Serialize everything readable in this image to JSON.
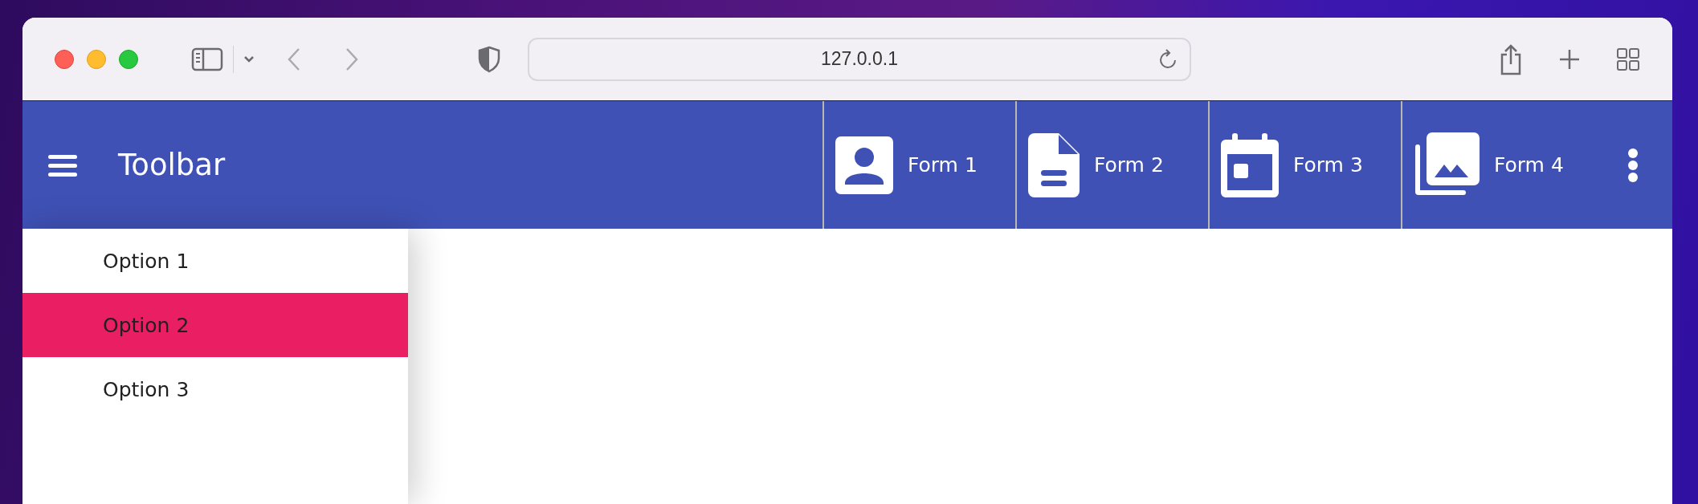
{
  "browser": {
    "url": "127.0.0.1"
  },
  "toolbar": {
    "title": "Toolbar",
    "tabs": [
      {
        "label": "Form 1",
        "kind": "person"
      },
      {
        "label": "Form 2",
        "kind": "document"
      },
      {
        "label": "Form 3",
        "kind": "calendar"
      },
      {
        "label": "Form 4",
        "kind": "photos"
      }
    ]
  },
  "drawer": {
    "items": [
      {
        "label": "Option 1",
        "selected": false
      },
      {
        "label": "Option 2",
        "selected": true
      },
      {
        "label": "Option 3",
        "selected": false
      }
    ]
  }
}
